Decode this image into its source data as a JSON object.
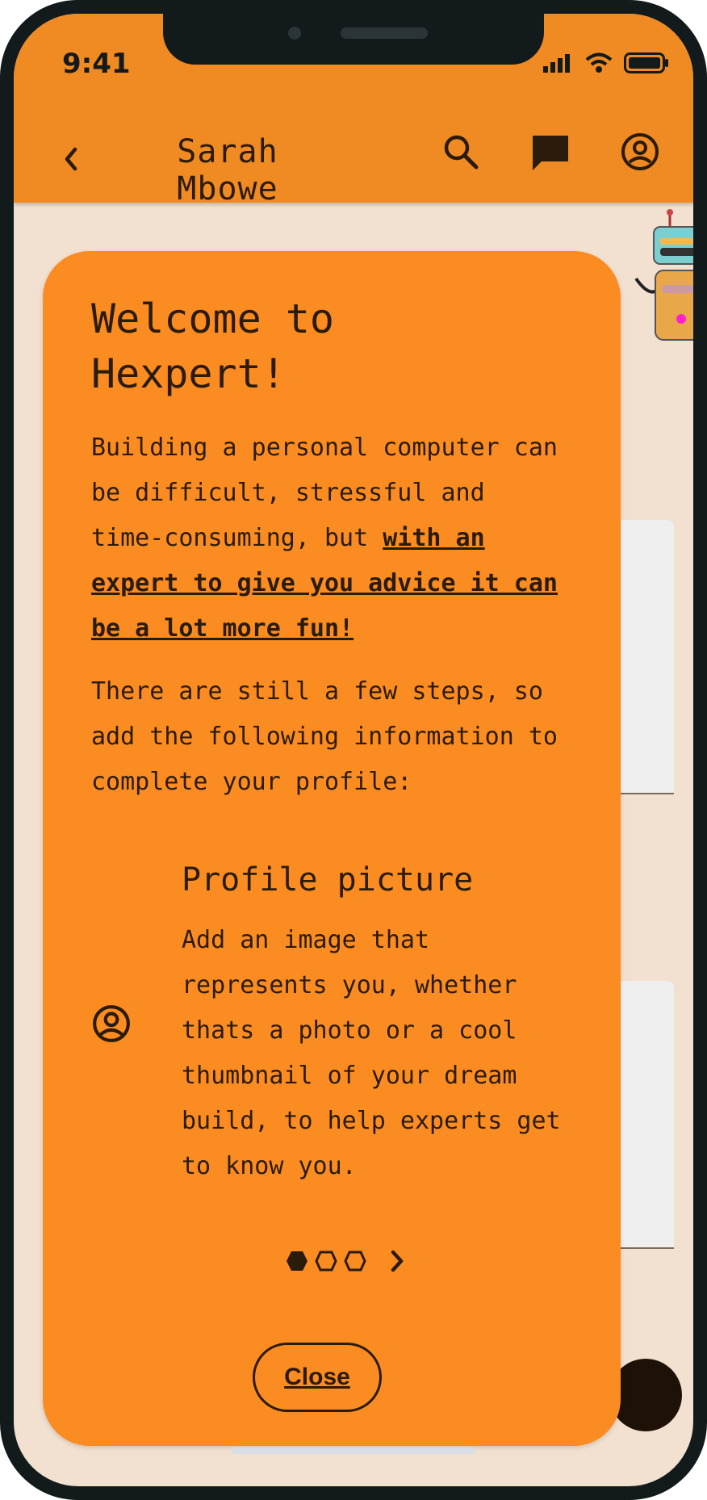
{
  "status_bar": {
    "time": "9:41"
  },
  "app_bar": {
    "title": "Sarah Mbowe",
    "icons": [
      "back-chevron-icon",
      "search-icon",
      "chat-icon",
      "account-circle-icon"
    ]
  },
  "modal": {
    "title": "Welcome to Hexpert!",
    "intro_plain": "Building a personal computer can be difficult, stressful and time-consuming, but ",
    "intro_link": "with an expert to give you advice it can be a lot more fun!",
    "steps_text": "There are still a few steps, so add the following information to complete your profile:",
    "feature": {
      "icon": "account-circle-icon",
      "title": "Profile picture",
      "description": "Add an image that represents you, whether thats a photo or a cool thumbnail of your dream build, to help experts get to know you."
    },
    "pager": {
      "current_page": 1,
      "total_pages": 3
    },
    "close_label": "Close"
  },
  "colors": {
    "app_bar": "#f08a22",
    "modal": "#fb8c22",
    "background": "#f2e0d0",
    "text": "#2b1b0a",
    "frame": "#121a1c"
  }
}
